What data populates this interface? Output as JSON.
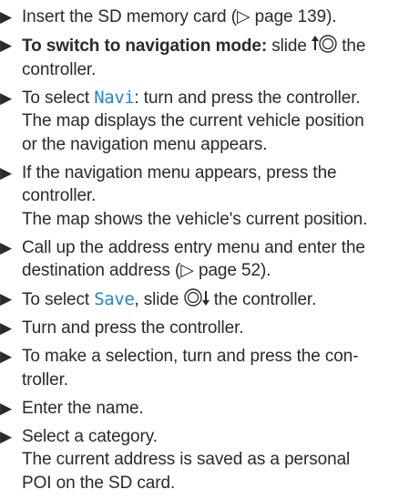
{
  "document": {
    "steps": [
      {
        "lines": [
          {
            "pre": "Insert the SD memory card (",
            "ref_marker": "▷",
            "ref": " page 139",
            "post": ")."
          }
        ]
      },
      {
        "bold_prefix": "To switch to navigation mode:",
        "text_pre": " slide ",
        "icon": "controller-slide-up-icon",
        "text_post": " the",
        "continuation": "controller."
      },
      {
        "pre": "To select ",
        "term": "Navi",
        "post": ": turn and press the controller.",
        "result_1": "The map displays the current vehicle position",
        "result_2": "or the navigation menu appears."
      },
      {
        "line_1": "If the navigation menu appears, press the",
        "line_2": "controller.",
        "result": "The map shows the vehicle's current position."
      },
      {
        "line_1": "Call up the address entry menu and enter the",
        "line_2_pre": "destination address (",
        "ref_marker": "▷",
        "line_2_ref": " page 52",
        "line_2_post": ")."
      },
      {
        "pre": "To select ",
        "term": "Save",
        "mid": ", slide ",
        "icon": "controller-slide-down-icon",
        "post": " the controller."
      },
      {
        "text": "Turn and press the controller."
      },
      {
        "line_1": "To make a selection, turn and press the con-",
        "line_2": "troller."
      },
      {
        "text": "Enter the name."
      },
      {
        "text": "Select a category.",
        "result_1": "The current address is saved as a personal",
        "result_2": "POI on the SD card."
      }
    ],
    "bullet_glyph": "▶",
    "colors": {
      "text": "#2a2a2a",
      "ui_term": "#1f86c9"
    }
  }
}
